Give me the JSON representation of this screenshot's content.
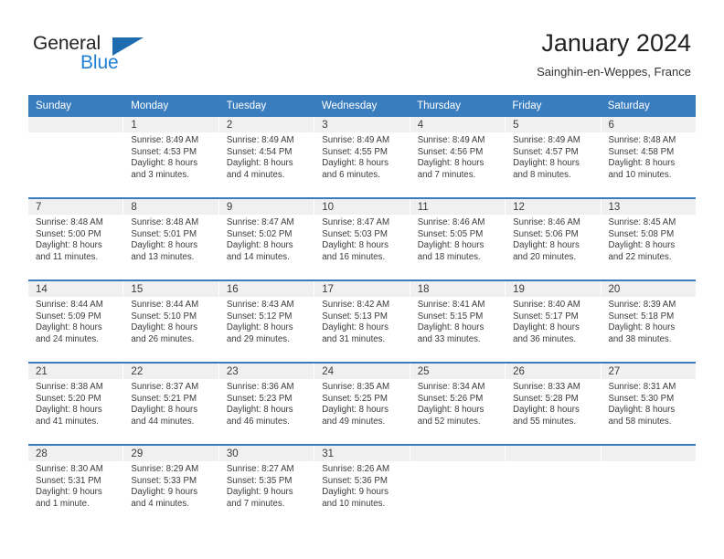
{
  "logo": {
    "word_top": "General",
    "word_bottom": "Blue",
    "triangle_color": "#1f6bb0",
    "blue_color": "#1f7fd4",
    "icon": "general-blue-logo"
  },
  "header": {
    "title": "January 2024",
    "subtitle": "Sainghin-en-Weppes, France"
  },
  "theme": {
    "header_row_bg": "#3a7dbf",
    "date_band_bg": "#f0f0f0",
    "text_color": "#3b3b3b"
  },
  "calendar": {
    "weekdays": [
      "Sunday",
      "Monday",
      "Tuesday",
      "Wednesday",
      "Thursday",
      "Friday",
      "Saturday"
    ],
    "weeks": [
      [
        {
          "day": "",
          "sunrise": "",
          "sunset": "",
          "daylight_line1": "",
          "daylight_line2": ""
        },
        {
          "day": "1",
          "sunrise": "Sunrise: 8:49 AM",
          "sunset": "Sunset: 4:53 PM",
          "daylight_line1": "Daylight: 8 hours",
          "daylight_line2": "and 3 minutes."
        },
        {
          "day": "2",
          "sunrise": "Sunrise: 8:49 AM",
          "sunset": "Sunset: 4:54 PM",
          "daylight_line1": "Daylight: 8 hours",
          "daylight_line2": "and 4 minutes."
        },
        {
          "day": "3",
          "sunrise": "Sunrise: 8:49 AM",
          "sunset": "Sunset: 4:55 PM",
          "daylight_line1": "Daylight: 8 hours",
          "daylight_line2": "and 6 minutes."
        },
        {
          "day": "4",
          "sunrise": "Sunrise: 8:49 AM",
          "sunset": "Sunset: 4:56 PM",
          "daylight_line1": "Daylight: 8 hours",
          "daylight_line2": "and 7 minutes."
        },
        {
          "day": "5",
          "sunrise": "Sunrise: 8:49 AM",
          "sunset": "Sunset: 4:57 PM",
          "daylight_line1": "Daylight: 8 hours",
          "daylight_line2": "and 8 minutes."
        },
        {
          "day": "6",
          "sunrise": "Sunrise: 8:48 AM",
          "sunset": "Sunset: 4:58 PM",
          "daylight_line1": "Daylight: 8 hours",
          "daylight_line2": "and 10 minutes."
        }
      ],
      [
        {
          "day": "7",
          "sunrise": "Sunrise: 8:48 AM",
          "sunset": "Sunset: 5:00 PM",
          "daylight_line1": "Daylight: 8 hours",
          "daylight_line2": "and 11 minutes."
        },
        {
          "day": "8",
          "sunrise": "Sunrise: 8:48 AM",
          "sunset": "Sunset: 5:01 PM",
          "daylight_line1": "Daylight: 8 hours",
          "daylight_line2": "and 13 minutes."
        },
        {
          "day": "9",
          "sunrise": "Sunrise: 8:47 AM",
          "sunset": "Sunset: 5:02 PM",
          "daylight_line1": "Daylight: 8 hours",
          "daylight_line2": "and 14 minutes."
        },
        {
          "day": "10",
          "sunrise": "Sunrise: 8:47 AM",
          "sunset": "Sunset: 5:03 PM",
          "daylight_line1": "Daylight: 8 hours",
          "daylight_line2": "and 16 minutes."
        },
        {
          "day": "11",
          "sunrise": "Sunrise: 8:46 AM",
          "sunset": "Sunset: 5:05 PM",
          "daylight_line1": "Daylight: 8 hours",
          "daylight_line2": "and 18 minutes."
        },
        {
          "day": "12",
          "sunrise": "Sunrise: 8:46 AM",
          "sunset": "Sunset: 5:06 PM",
          "daylight_line1": "Daylight: 8 hours",
          "daylight_line2": "and 20 minutes."
        },
        {
          "day": "13",
          "sunrise": "Sunrise: 8:45 AM",
          "sunset": "Sunset: 5:08 PM",
          "daylight_line1": "Daylight: 8 hours",
          "daylight_line2": "and 22 minutes."
        }
      ],
      [
        {
          "day": "14",
          "sunrise": "Sunrise: 8:44 AM",
          "sunset": "Sunset: 5:09 PM",
          "daylight_line1": "Daylight: 8 hours",
          "daylight_line2": "and 24 minutes."
        },
        {
          "day": "15",
          "sunrise": "Sunrise: 8:44 AM",
          "sunset": "Sunset: 5:10 PM",
          "daylight_line1": "Daylight: 8 hours",
          "daylight_line2": "and 26 minutes."
        },
        {
          "day": "16",
          "sunrise": "Sunrise: 8:43 AM",
          "sunset": "Sunset: 5:12 PM",
          "daylight_line1": "Daylight: 8 hours",
          "daylight_line2": "and 29 minutes."
        },
        {
          "day": "17",
          "sunrise": "Sunrise: 8:42 AM",
          "sunset": "Sunset: 5:13 PM",
          "daylight_line1": "Daylight: 8 hours",
          "daylight_line2": "and 31 minutes."
        },
        {
          "day": "18",
          "sunrise": "Sunrise: 8:41 AM",
          "sunset": "Sunset: 5:15 PM",
          "daylight_line1": "Daylight: 8 hours",
          "daylight_line2": "and 33 minutes."
        },
        {
          "day": "19",
          "sunrise": "Sunrise: 8:40 AM",
          "sunset": "Sunset: 5:17 PM",
          "daylight_line1": "Daylight: 8 hours",
          "daylight_line2": "and 36 minutes."
        },
        {
          "day": "20",
          "sunrise": "Sunrise: 8:39 AM",
          "sunset": "Sunset: 5:18 PM",
          "daylight_line1": "Daylight: 8 hours",
          "daylight_line2": "and 38 minutes."
        }
      ],
      [
        {
          "day": "21",
          "sunrise": "Sunrise: 8:38 AM",
          "sunset": "Sunset: 5:20 PM",
          "daylight_line1": "Daylight: 8 hours",
          "daylight_line2": "and 41 minutes."
        },
        {
          "day": "22",
          "sunrise": "Sunrise: 8:37 AM",
          "sunset": "Sunset: 5:21 PM",
          "daylight_line1": "Daylight: 8 hours",
          "daylight_line2": "and 44 minutes."
        },
        {
          "day": "23",
          "sunrise": "Sunrise: 8:36 AM",
          "sunset": "Sunset: 5:23 PM",
          "daylight_line1": "Daylight: 8 hours",
          "daylight_line2": "and 46 minutes."
        },
        {
          "day": "24",
          "sunrise": "Sunrise: 8:35 AM",
          "sunset": "Sunset: 5:25 PM",
          "daylight_line1": "Daylight: 8 hours",
          "daylight_line2": "and 49 minutes."
        },
        {
          "day": "25",
          "sunrise": "Sunrise: 8:34 AM",
          "sunset": "Sunset: 5:26 PM",
          "daylight_line1": "Daylight: 8 hours",
          "daylight_line2": "and 52 minutes."
        },
        {
          "day": "26",
          "sunrise": "Sunrise: 8:33 AM",
          "sunset": "Sunset: 5:28 PM",
          "daylight_line1": "Daylight: 8 hours",
          "daylight_line2": "and 55 minutes."
        },
        {
          "day": "27",
          "sunrise": "Sunrise: 8:31 AM",
          "sunset": "Sunset: 5:30 PM",
          "daylight_line1": "Daylight: 8 hours",
          "daylight_line2": "and 58 minutes."
        }
      ],
      [
        {
          "day": "28",
          "sunrise": "Sunrise: 8:30 AM",
          "sunset": "Sunset: 5:31 PM",
          "daylight_line1": "Daylight: 9 hours",
          "daylight_line2": "and 1 minute."
        },
        {
          "day": "29",
          "sunrise": "Sunrise: 8:29 AM",
          "sunset": "Sunset: 5:33 PM",
          "daylight_line1": "Daylight: 9 hours",
          "daylight_line2": "and 4 minutes."
        },
        {
          "day": "30",
          "sunrise": "Sunrise: 8:27 AM",
          "sunset": "Sunset: 5:35 PM",
          "daylight_line1": "Daylight: 9 hours",
          "daylight_line2": "and 7 minutes."
        },
        {
          "day": "31",
          "sunrise": "Sunrise: 8:26 AM",
          "sunset": "Sunset: 5:36 PM",
          "daylight_line1": "Daylight: 9 hours",
          "daylight_line2": "and 10 minutes."
        },
        {
          "day": "",
          "sunrise": "",
          "sunset": "",
          "daylight_line1": "",
          "daylight_line2": ""
        },
        {
          "day": "",
          "sunrise": "",
          "sunset": "",
          "daylight_line1": "",
          "daylight_line2": ""
        },
        {
          "day": "",
          "sunrise": "",
          "sunset": "",
          "daylight_line1": "",
          "daylight_line2": ""
        }
      ]
    ]
  }
}
